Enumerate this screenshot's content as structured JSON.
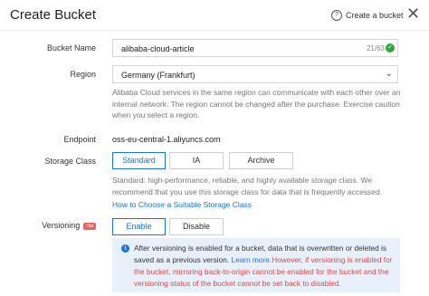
{
  "header": {
    "title": "Create Bucket",
    "help_link": "Create a bucket",
    "close_glyph": "✕"
  },
  "form": {
    "bucket_name": {
      "label": "Bucket Name",
      "value": "alibaba-cloud-article",
      "counter": "21/63"
    },
    "region": {
      "label": "Region",
      "selected": "Germany (Frankfurt)",
      "note": "Alibaba Cloud services in the same region can communicate with each other over an internal network. The region cannot be changed after the purchase. Exercise caution when you select a region."
    },
    "endpoint": {
      "label": "Endpoint",
      "value": "oss-eu-central-1.aliyuncs.com"
    },
    "storage_class": {
      "label": "Storage Class",
      "options": [
        "Standard",
        "IA",
        "Archive"
      ],
      "selected": "Standard",
      "note": "Standard: high-performance, reliable, and highly available storage class. We recommend that you use this storage class for data that is frequently accessed.",
      "link": "How to Choose a Suitable Storage Class"
    },
    "versioning": {
      "label": "Versioning",
      "badge": "Hot",
      "options": [
        "Enable",
        "Disable"
      ],
      "selected": "Enable",
      "info_plain": "After versioning is enabled for a bucket, data that is overwritten or deleted is saved as a previous version. ",
      "info_link": "Learn more.",
      "info_warning": "However, if versioning is enabled for the bucket, mirroring back-to-origin cannot be enabled for the bucket and the versioning status of the bucket cannot be set back to disabled."
    }
  },
  "colors": {
    "accent": "#1a73e8",
    "success": "#2da641",
    "warning": "#e54545",
    "hot_badge": "#f06060",
    "info_bg": "#e8f1fb"
  },
  "icons": [
    "help-circle-icon",
    "close-icon",
    "check-circle-icon",
    "chevron-down-icon",
    "info-icon"
  ]
}
